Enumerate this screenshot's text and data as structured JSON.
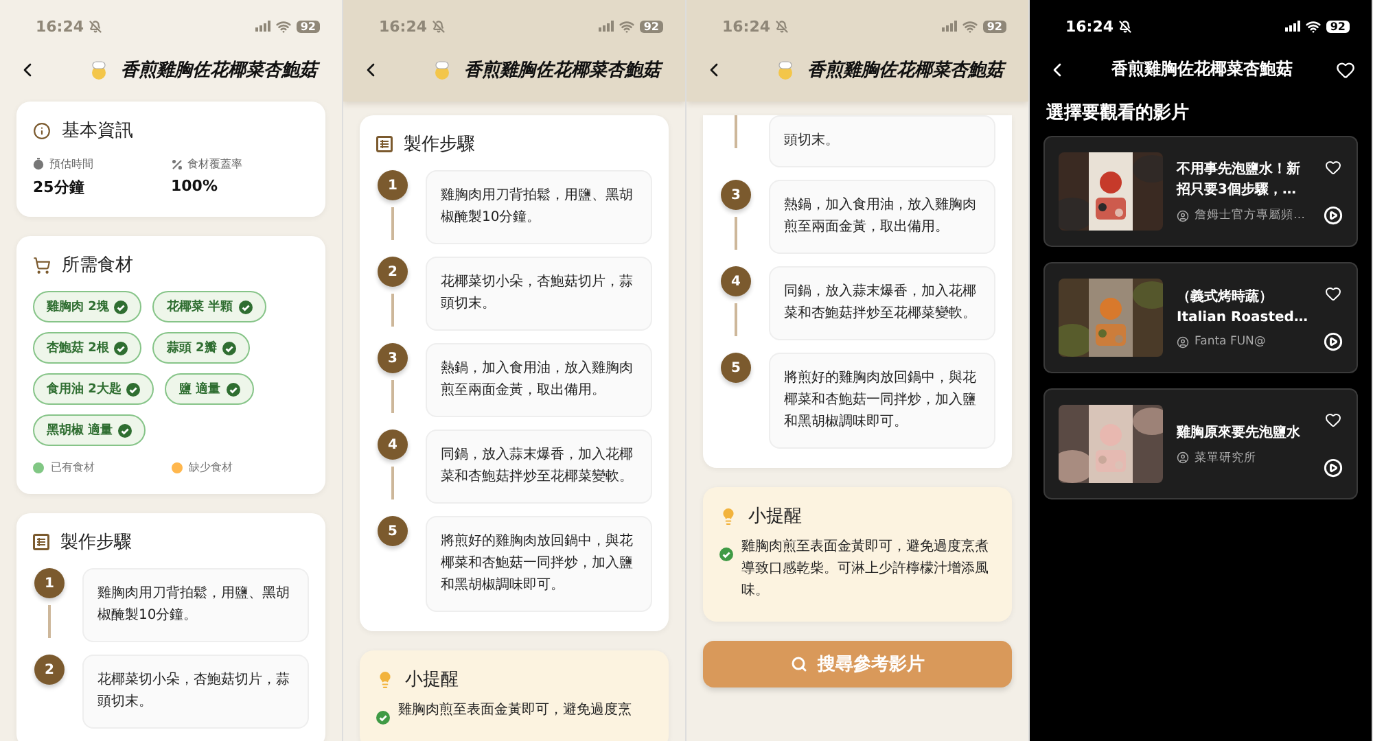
{
  "screens": [
    {
      "kind": "recipe",
      "status": {
        "time": "16:24",
        "battery": "92"
      },
      "header": {
        "title": "香煎雞胸佐花椰菜杏鮑菇",
        "shaded": false
      },
      "sections": [
        {
          "kind": "info",
          "title": "基本資訊",
          "stats": [
            {
              "label": "預估時間",
              "value": "25分鐘"
            },
            {
              "label": "食材覆蓋率",
              "value": "100%"
            }
          ]
        },
        {
          "kind": "ingredients",
          "title": "所需食材",
          "items": [
            {
              "name": "雞胸肉 2塊",
              "owned": true
            },
            {
              "name": "花椰菜 半顆",
              "owned": true
            },
            {
              "name": "杏鮑菇 2根",
              "owned": true
            },
            {
              "name": "蒜頭 2瓣",
              "owned": true
            },
            {
              "name": "食用油 2大匙",
              "owned": true
            },
            {
              "name": "鹽 適量",
              "owned": true
            },
            {
              "name": "黑胡椒 適量",
              "owned": true
            }
          ],
          "legend": [
            {
              "label": "已有食材",
              "color": "#81c784"
            },
            {
              "label": "缺少食材",
              "color": "#ffb74d"
            }
          ]
        },
        {
          "kind": "steps",
          "title": "製作步驟",
          "steps": [
            {
              "number": "1",
              "text": "雞胸肉用刀背拍鬆，用鹽、黑胡椒醃製10分鐘。"
            },
            {
              "number": "2",
              "text": "花椰菜切小朵，杏鮑菇切片，蒜頭切末。"
            }
          ]
        }
      ]
    },
    {
      "kind": "recipe",
      "status": {
        "time": "16:24",
        "battery": "92"
      },
      "header": {
        "title": "香煎雞胸佐花椰菜杏鮑菇",
        "shaded": true
      },
      "sections": [
        {
          "kind": "steps",
          "title": "製作步驟",
          "steps": [
            {
              "number": "1",
              "text": "雞胸肉用刀背拍鬆，用鹽、黑胡椒醃製10分鐘。"
            },
            {
              "number": "2",
              "text": "花椰菜切小朵，杏鮑菇切片，蒜頭切末。"
            },
            {
              "number": "3",
              "text": "熱鍋，加入食用油，放入雞胸肉煎至兩面金黃，取出備用。"
            },
            {
              "number": "4",
              "text": "同鍋，放入蒜末爆香，加入花椰菜和杏鮑菇拌炒至花椰菜變軟。"
            },
            {
              "number": "5",
              "text": "將煎好的雞胸肉放回鍋中，與花椰菜和杏鮑菇一同拌炒，加入鹽和黑胡椒調味即可。"
            }
          ]
        },
        {
          "kind": "tip",
          "title": "小提醒",
          "text": "雞胸肉煎至表面金黃即可，避免過度烹"
        }
      ]
    },
    {
      "kind": "recipe",
      "status": {
        "time": "16:24",
        "battery": "92"
      },
      "header": {
        "title": "香煎雞胸佐花椰菜杏鮑菇",
        "shaded": true
      },
      "sections": [
        {
          "kind": "steps",
          "steps": [
            {
              "text": "頭切末。"
            },
            {
              "number": "3",
              "text": "熱鍋，加入食用油，放入雞胸肉煎至兩面金黃，取出備用。"
            },
            {
              "number": "4",
              "text": "同鍋，放入蒜末爆香，加入花椰菜和杏鮑菇拌炒至花椰菜變軟。"
            },
            {
              "number": "5",
              "text": "將煎好的雞胸肉放回鍋中，與花椰菜和杏鮑菇一同拌炒，加入鹽和黑胡椒調味即可。"
            }
          ]
        },
        {
          "kind": "tip",
          "title": "小提醒",
          "text": "雞胸肉煎至表面金黃即可，避免過度烹煮導致口感乾柴。可淋上少許檸檬汁增添風味。"
        },
        {
          "kind": "button",
          "label": "搜尋參考影片"
        }
      ]
    },
    {
      "kind": "videos",
      "status": {
        "time": "16:24",
        "battery": "92"
      },
      "header": {
        "title": "香煎雞胸佐花椰菜杏鮑菇"
      },
      "heading": "選擇要觀看的影片",
      "videos": [
        {
          "title": "不用事先泡鹽水！新招只要3個步驟，…",
          "channel": "詹姆士官方專屬頻…"
        },
        {
          "title": "（義式烤時蔬）Italian Roasted…",
          "channel": "Fanta FUN@"
        },
        {
          "title": "雞胸原來要先泡鹽水",
          "channel": "菜單研究所"
        }
      ]
    }
  ]
}
